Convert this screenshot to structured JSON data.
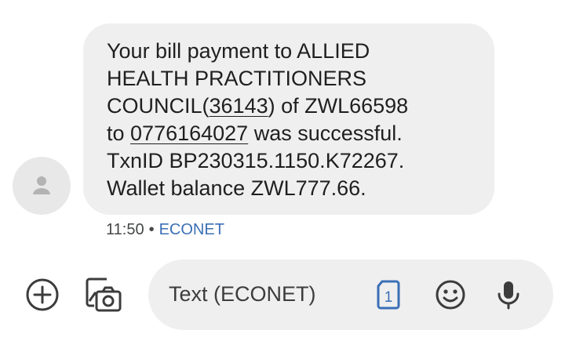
{
  "message": {
    "lines": [
      {
        "text": "Your bill payment to ALLIED"
      },
      {
        "text": "HEALTH PRACTITIONERS"
      },
      {
        "pre": "COUNCIL(",
        "link": "36143",
        "post": ") of ZWL66598"
      },
      {
        "pre": "to ",
        "link": "0776164027",
        "post": " was successful."
      },
      {
        "text": "TxnID BP230315.1150.K72267."
      },
      {
        "text": "Wallet balance ZWL777.66."
      }
    ],
    "time": "11:50",
    "separator": "•",
    "carrier": "ECONET"
  },
  "compose": {
    "placeholder": "Text (ECONET)",
    "sim_number": "1"
  },
  "icons": {
    "avatar": "person-icon",
    "add": "add-circle-icon",
    "gallery": "gallery-camera-icon",
    "sim": "sim-card-icon",
    "emoji": "emoji-icon",
    "mic": "microphone-icon"
  },
  "colors": {
    "bubble": "#efefef",
    "text": "#1f1f1f",
    "carrier": "#3b6fb6",
    "sim": "#3b6fb6"
  }
}
